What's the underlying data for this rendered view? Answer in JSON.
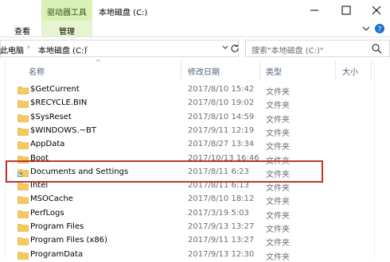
{
  "ribbon": {
    "context_tab": "驱动器工具",
    "window_title": "本地磁盘 (C:)",
    "tabs": [
      {
        "label": "查看"
      },
      {
        "label": "管理"
      }
    ]
  },
  "address": {
    "crumbs": [
      "此电脑",
      "本地磁盘 (C:)"
    ],
    "search_placeholder": "搜索\"本地磁盘 (C:)\""
  },
  "columns": {
    "name": "名称",
    "date": "修改日期",
    "type": "类型",
    "size": "大小"
  },
  "files": [
    {
      "name": "$GetCurrent",
      "date": "2017/8/10 15:42",
      "type": "文件夹",
      "shortcut": false
    },
    {
      "name": "$RECYCLE.BIN",
      "date": "2017/8/10 19:02",
      "type": "文件夹",
      "shortcut": false
    },
    {
      "name": "$SysReset",
      "date": "2017/8/10 14:59",
      "type": "文件夹",
      "shortcut": false
    },
    {
      "name": "$WINDOWS.~BT",
      "date": "2017/9/11 12:19",
      "type": "文件夹",
      "shortcut": false
    },
    {
      "name": "AppData",
      "date": "2017/8/27 13:34",
      "type": "文件夹",
      "shortcut": false
    },
    {
      "name": "Boot",
      "date": "2017/10/13 16:46",
      "type": "文件夹",
      "shortcut": false
    },
    {
      "name": "Documents and Settings",
      "date": "2017/8/11 6:23",
      "type": "文件夹",
      "shortcut": true
    },
    {
      "name": "Intel",
      "date": "2017/8/11 6:13",
      "type": "文件夹",
      "shortcut": false
    },
    {
      "name": "MSOCache",
      "date": "2017/8/10 18:12",
      "type": "文件夹",
      "shortcut": false
    },
    {
      "name": "PerfLogs",
      "date": "2017/3/19 5:03",
      "type": "文件夹",
      "shortcut": false
    },
    {
      "name": "Program Files",
      "date": "2017/9/13 13:27",
      "type": "文件夹",
      "shortcut": false
    },
    {
      "name": "Program Files (x86)",
      "date": "2017/9/11 13:27",
      "type": "文件夹",
      "shortcut": false
    },
    {
      "name": "ProgramData",
      "date": "2017/9/13 12:30",
      "type": "文件夹",
      "shortcut": false
    }
  ],
  "colors": {
    "accent_context": "#d9f0b7",
    "highlight_box": "#c0342c",
    "folder": "#f4c95d"
  }
}
